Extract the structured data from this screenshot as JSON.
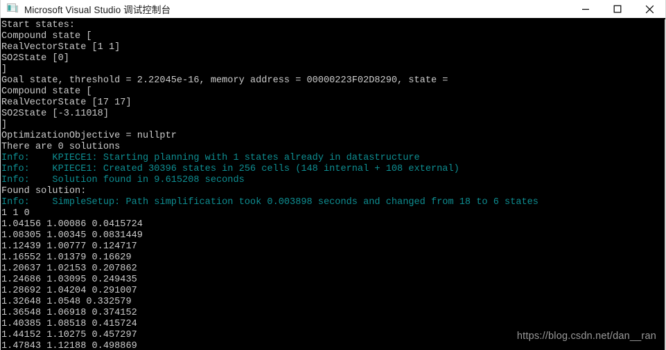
{
  "window": {
    "title": "Microsoft Visual Studio 调试控制台",
    "app_icon": "console-app-icon",
    "controls": {
      "minimize": "minimize-button",
      "maximize": "maximize-button",
      "close": "close-button"
    }
  },
  "colors": {
    "titlebar_bg": "#ffffff",
    "titlebar_text": "#1a1a1a",
    "console_bg": "#000000",
    "console_text": "#cccccc",
    "info_text": "#0e8e92",
    "watermark_text": "#9a9a9a"
  },
  "console": {
    "lines": [
      {
        "text": "Start states:",
        "style": "plain"
      },
      {
        "text": "Compound state [",
        "style": "plain"
      },
      {
        "text": "RealVectorState [1 1]",
        "style": "plain"
      },
      {
        "text": "SO2State [0]",
        "style": "plain"
      },
      {
        "text": "]",
        "style": "plain"
      },
      {
        "text": "Goal state, threshold = 2.22045e-16, memory address = 00000223F02D8290, state =",
        "style": "plain"
      },
      {
        "text": "Compound state [",
        "style": "plain"
      },
      {
        "text": "RealVectorState [17 17]",
        "style": "plain"
      },
      {
        "text": "SO2State [-3.11018]",
        "style": "plain"
      },
      {
        "text": "]",
        "style": "plain"
      },
      {
        "text": "OptimizationObjective = nullptr",
        "style": "plain"
      },
      {
        "text": "There are 0 solutions",
        "style": "plain"
      },
      {
        "text": "Info:    KPIECE1: Starting planning with 1 states already in datastructure",
        "style": "info"
      },
      {
        "text": "Info:    KPIECE1: Created 30396 states in 256 cells (148 internal + 108 external)",
        "style": "info"
      },
      {
        "text": "Info:    Solution found in 9.615208 seconds",
        "style": "info"
      },
      {
        "text": "Found solution:",
        "style": "plain"
      },
      {
        "text": "Info:    SimpleSetup: Path simplification took 0.003898 seconds and changed from 18 to 6 states",
        "style": "info"
      },
      {
        "text": "1 1 0",
        "style": "plain"
      },
      {
        "text": "1.04156 1.00086 0.0415724",
        "style": "plain"
      },
      {
        "text": "1.08305 1.00345 0.0831449",
        "style": "plain"
      },
      {
        "text": "1.12439 1.00777 0.124717",
        "style": "plain"
      },
      {
        "text": "1.16552 1.01379 0.16629",
        "style": "plain"
      },
      {
        "text": "1.20637 1.02153 0.207862",
        "style": "plain"
      },
      {
        "text": "1.24686 1.03095 0.249435",
        "style": "plain"
      },
      {
        "text": "1.28692 1.04204 0.291007",
        "style": "plain"
      },
      {
        "text": "1.32648 1.0548 0.332579",
        "style": "plain"
      },
      {
        "text": "1.36548 1.06918 0.374152",
        "style": "plain"
      },
      {
        "text": "1.40385 1.08518 0.415724",
        "style": "plain"
      },
      {
        "text": "1.44152 1.10275 0.457297",
        "style": "plain"
      },
      {
        "text": "1.47843 1.12188 0.498869",
        "style": "plain"
      }
    ]
  },
  "watermark": {
    "text": "https://blog.csdn.net/dan__ran"
  }
}
